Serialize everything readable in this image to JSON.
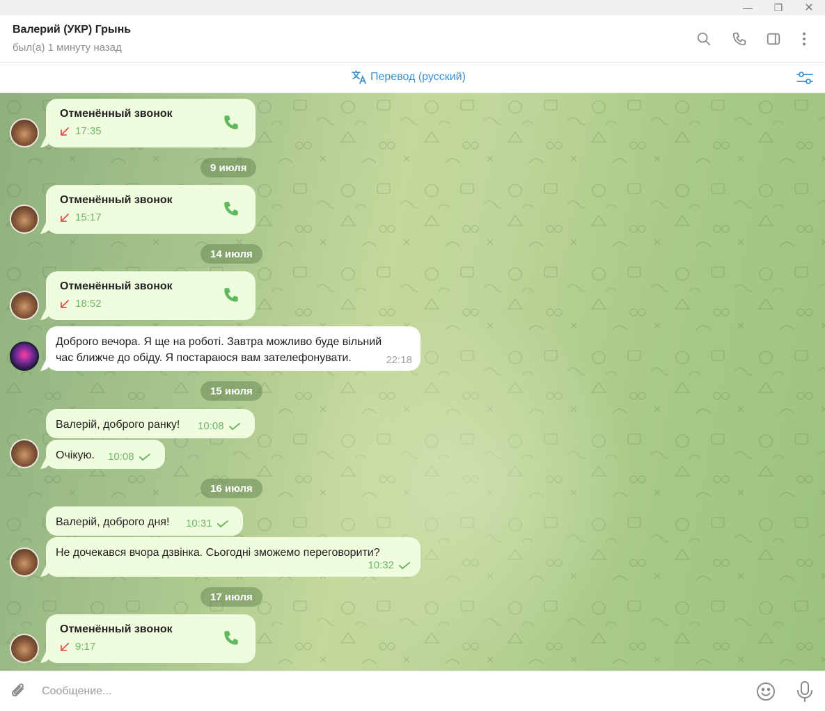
{
  "window": {
    "minimize": "—",
    "maximize": "❐",
    "close": "✕"
  },
  "header": {
    "name": "Валерий (УКР) Грынь",
    "status": "был(а) 1 минуту назад",
    "icons": [
      "search-icon",
      "phone-icon",
      "sidebar-toggle-icon",
      "more-vertical-icon"
    ]
  },
  "translate": {
    "label": "Перевод (русский)"
  },
  "colors": {
    "accent": "#3a8fd0",
    "outgoing_bubble": "#effdde",
    "missed_call": "#e05050",
    "check": "#6fb36a"
  },
  "messages": {
    "call1": {
      "title": "Отменённый звонок",
      "time": "17:35"
    },
    "date1": "9 июля",
    "call2": {
      "title": "Отменённый звонок",
      "time": "15:17"
    },
    "date2": "14 июля",
    "call3": {
      "title": "Отменённый звонок",
      "time": "18:52"
    },
    "in1": {
      "line1": "Доброго вечора. Я ще на роботі. Завтра можливо буде вільний",
      "line2": "час ближче до обіду. Я постараюся вам зателефонувати.",
      "time": "22:18"
    },
    "date3": "15 июля",
    "out1": {
      "text": "Валерій, доброго ранку!",
      "time": "10:08"
    },
    "out2": {
      "text": "Очікую.",
      "time": "10:08"
    },
    "date4": "16 июля",
    "out3": {
      "text": "Валерій, доброго дня!",
      "time": "10:31"
    },
    "out4": {
      "text": "Не дочекався вчора дзвінка. Сьогодні зможемо переговорити?",
      "time": "10:32"
    },
    "date5": "17 июля",
    "call4": {
      "title": "Отменённый звонок",
      "time": "9:17"
    }
  },
  "composer": {
    "placeholder": "Сообщение..."
  }
}
